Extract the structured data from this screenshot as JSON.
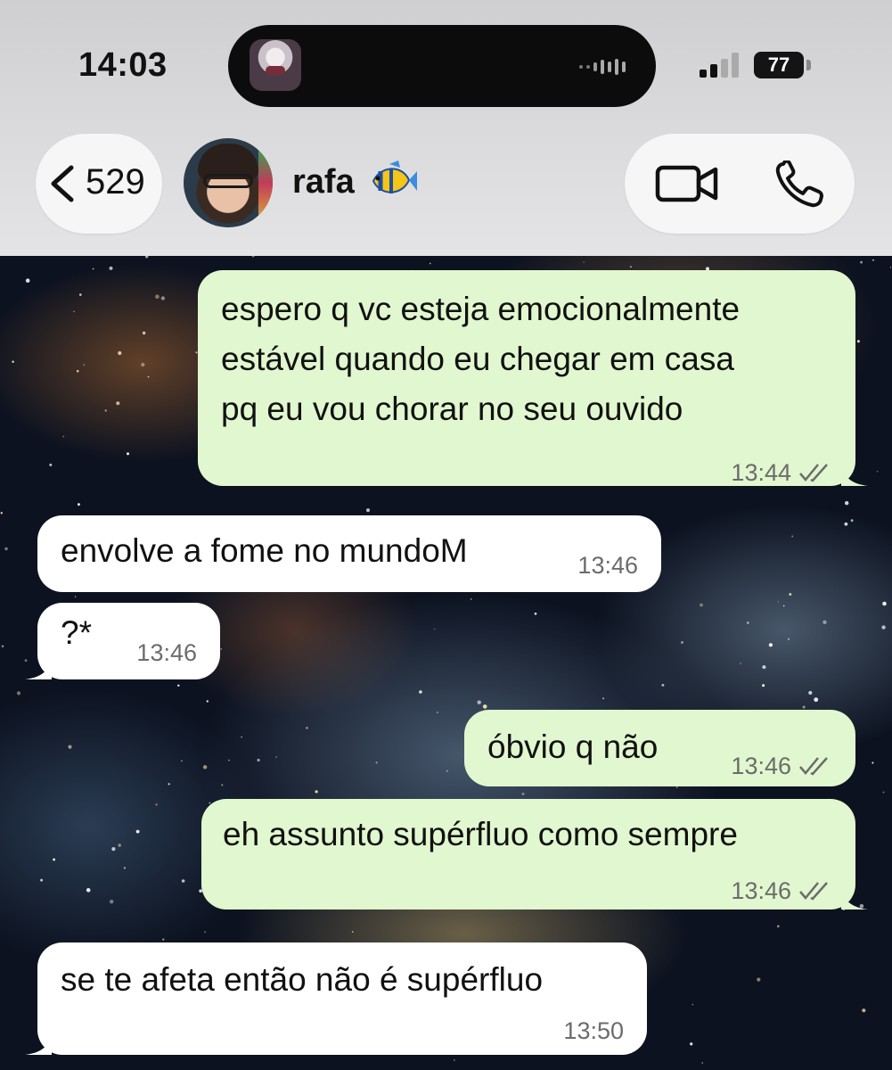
{
  "status_bar": {
    "time": "14:03",
    "battery": "77"
  },
  "header": {
    "back_count": "529",
    "contact_name": "rafa",
    "contact_emoji_icon": "tropical-fish-icon"
  },
  "messages": [
    {
      "direction": "out",
      "text": "espero q vc esteja emocionalmente\nestável quando eu chegar em casa\npq eu vou chorar no seu ouvido",
      "time": "13:44",
      "read": true
    },
    {
      "direction": "in",
      "text": "envolve a fome no mundoM",
      "time": "13:46"
    },
    {
      "direction": "in",
      "text": "?*",
      "time": "13:46"
    },
    {
      "direction": "out",
      "text": "óbvio q não",
      "time": "13:46",
      "read": true
    },
    {
      "direction": "out",
      "text": "eh assunto supérfluo como sempre",
      "time": "13:46",
      "read": true
    },
    {
      "direction": "in",
      "text": "se te afeta então não é supérfluo",
      "time": "13:50"
    }
  ]
}
